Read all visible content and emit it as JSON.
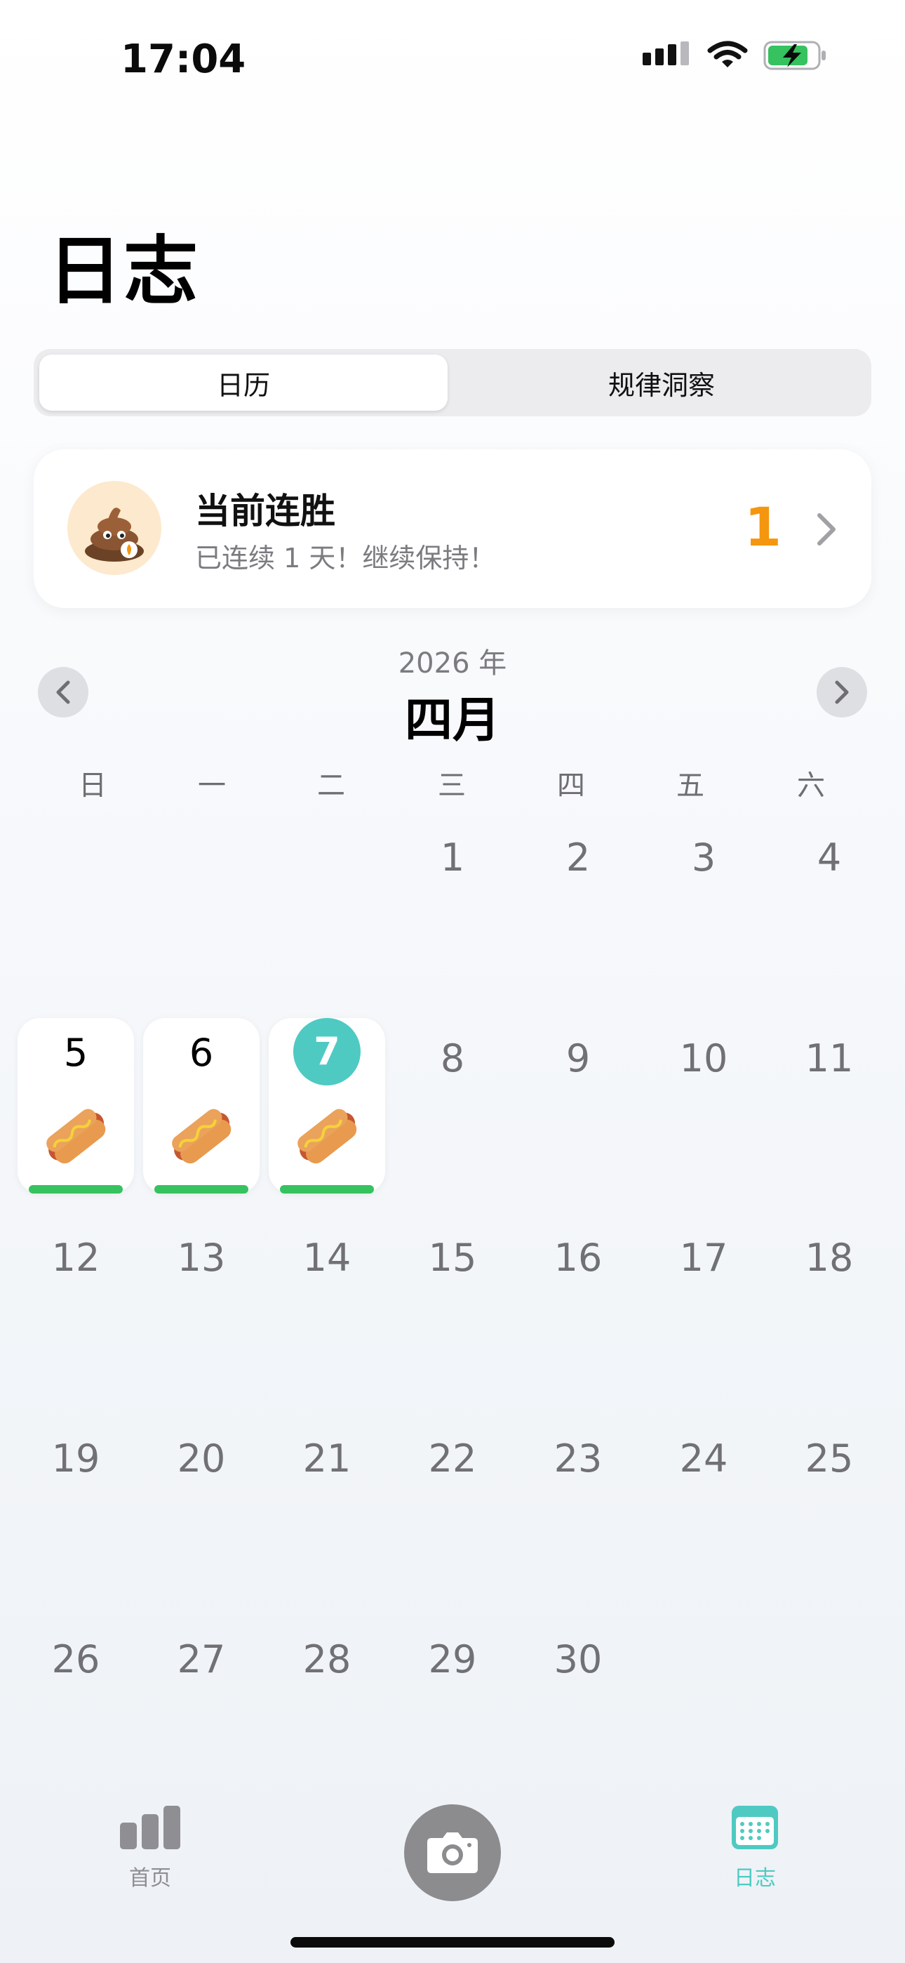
{
  "status_bar": {
    "time": "17:04",
    "icons": [
      "cellular-icon",
      "wifi-icon",
      "battery-charging-icon"
    ],
    "battery_color": "#35c25f"
  },
  "header": {
    "title": "日志"
  },
  "segmented_control": {
    "options": [
      "日历",
      "规律洞察"
    ],
    "selected": "日历"
  },
  "streak": {
    "title": "当前连胜",
    "subtitle": "已连续 1 天！继续保持！",
    "count": "1",
    "avatar_icon": "poop-icon",
    "count_color": "#f5960f"
  },
  "calendar": {
    "year": "2026 年",
    "month": "四月",
    "weekdays": [
      "日",
      "一",
      "二",
      "三",
      "四",
      "五",
      "六"
    ],
    "prev_icon": "chevron-left-icon",
    "next_icon": "chevron-right-icon",
    "days": {
      "d1": "1",
      "d2": "2",
      "d3": "3",
      "d4": "4",
      "d5": "5",
      "d6": "6",
      "d7": "7",
      "d8": "8",
      "d9": "9",
      "d10": "10",
      "d11": "11",
      "d12": "12",
      "d13": "13",
      "d14": "14",
      "d15": "15",
      "d16": "16",
      "d17": "17",
      "d18": "18",
      "d19": "19",
      "d20": "20",
      "d21": "21",
      "d22": "22",
      "d23": "23",
      "d24": "24",
      "d25": "25",
      "d26": "26",
      "d27": "27",
      "d28": "28",
      "d29": "29",
      "d30": "30"
    },
    "logged_days": [
      "5",
      "6",
      "7"
    ],
    "today": "7",
    "log_icon": "hotdog-icon",
    "accent_color": "#4ecac2",
    "log_bar_color": "#35c25f"
  },
  "tab_bar": {
    "home_label": "首页",
    "journal_label": "日志",
    "camera_icon": "camera-icon",
    "active_tab": "日志"
  }
}
